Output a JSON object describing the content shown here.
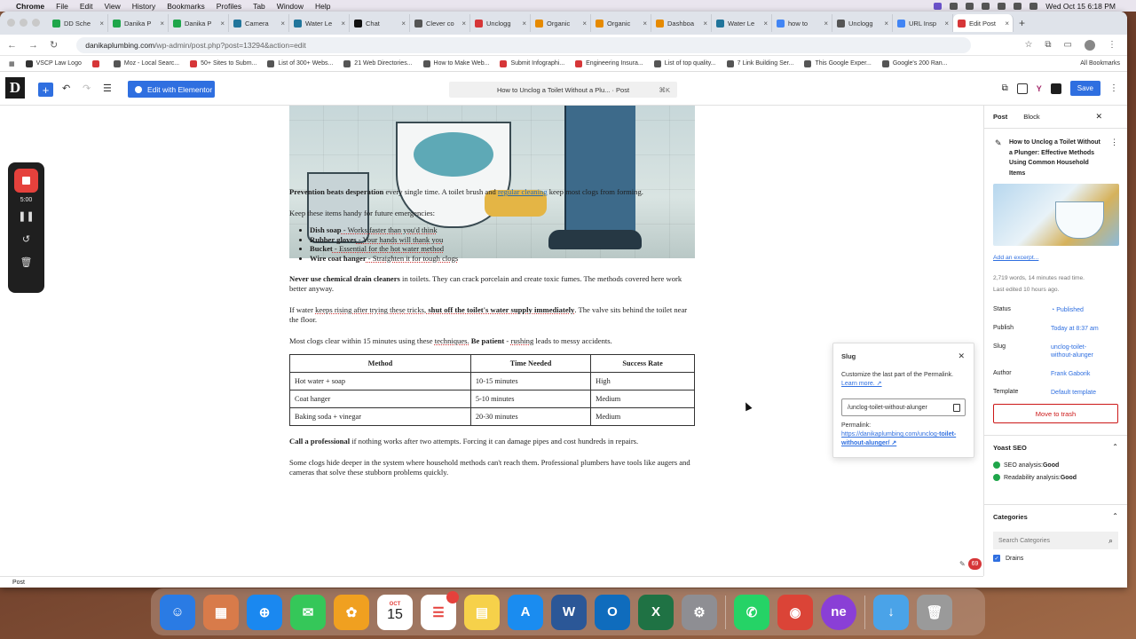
{
  "menubar": {
    "apple": "",
    "app": "Chrome",
    "items": [
      "File",
      "Edit",
      "View",
      "History",
      "Bookmarks",
      "Profiles",
      "Tab",
      "Window",
      "Help"
    ],
    "datetime": "Wed Oct 15  6:18 PM"
  },
  "tabs": [
    {
      "label": "DD Sche",
      "color": "#1fa64a"
    },
    {
      "label": "Danika P",
      "color": "#1fa64a"
    },
    {
      "label": "Danika P",
      "color": "#1fa64a"
    },
    {
      "label": "Camera",
      "color": "#21759b"
    },
    {
      "label": "Water Le",
      "color": "#21759b"
    },
    {
      "label": "Chat",
      "color": "#111111"
    },
    {
      "label": "Clever co",
      "color": "#555555"
    },
    {
      "label": "Unclogg",
      "color": "#d63638"
    },
    {
      "label": "Organic",
      "color": "#e68a00"
    },
    {
      "label": "Organic",
      "color": "#e68a00"
    },
    {
      "label": "Dashboa",
      "color": "#e68a00"
    },
    {
      "label": "Water Le",
      "color": "#21759b"
    },
    {
      "label": "how to",
      "color": "#4285f4"
    },
    {
      "label": "Unclogg",
      "color": "#555555"
    },
    {
      "label": "URL Insp",
      "color": "#4285f4"
    },
    {
      "label": "Edit Post",
      "color": "#d63638",
      "active": true
    }
  ],
  "address": {
    "domain": "danikaplumbing.com",
    "path": "/wp-admin/post.php?post=13294&action=edit"
  },
  "bookmarks": [
    {
      "label": "VSCP Law Logo",
      "color": "#333"
    },
    {
      "label": "",
      "color": "#d63638"
    },
    {
      "label": "Moz - Local Searc...",
      "color": "#555"
    },
    {
      "label": "50+ Sites to Subm...",
      "color": "#d63638"
    },
    {
      "label": "List of 300+ Webs...",
      "color": "#555"
    },
    {
      "label": "21 Web Directories...",
      "color": "#555"
    },
    {
      "label": "How to Make Web...",
      "color": "#555"
    },
    {
      "label": "Submit Infographi...",
      "color": "#d63638"
    },
    {
      "label": "Engineering Insura...",
      "color": "#d63638"
    },
    {
      "label": "List of top quality...",
      "color": "#555"
    },
    {
      "label": "7 Link Building Ser...",
      "color": "#555"
    },
    {
      "label": "This Google Exper...",
      "color": "#555"
    },
    {
      "label": "Google's 200 Ran...",
      "color": "#555"
    }
  ],
  "bookmarks_all": "All Bookmarks",
  "wp": {
    "logo": "D",
    "elementor": "Edit with Elementor",
    "doc_title": "How to Unclog a Toilet Without a Plu...",
    "doc_type": "· Post",
    "shortcut": "⌘K",
    "save": "Save"
  },
  "recorder": {
    "time": "5:00"
  },
  "article": {
    "p1_bold": "Prevention beats desperation",
    "p1_a": " every single time. A toilet brush and ",
    "p1_link": "regular cleaning",
    "p1_b": " keep most clogs from forming.",
    "p2": "Keep these items handy for future emergencies:",
    "list": [
      {
        "b": "Dish soap",
        "t": " - Works faster than you'd think"
      },
      {
        "b": "Rubber gloves",
        "t": " - Your hands will thank you"
      },
      {
        "b": "Bucket",
        "t": " - Essential for the hot water method"
      },
      {
        "b": "Wire coat hanger",
        "t": " - Straighten it for tough clogs"
      }
    ],
    "p3_bold": "Never use chemical drain cleaners",
    "p3_t": " in toilets. They can crack porcelain and create toxic fumes. The methods covered here work better anyway.",
    "p4_a": "If water ",
    "p4_u": "keeps rising after trying these tricks,",
    "p4_bold": " shut off the toilet's water supply immediately",
    "p4_b": ". The valve sits behind the toilet near the floor.",
    "p5_a": "Most clogs clear within 15 minutes using these ",
    "p5_u": "techniques.",
    "p5_bold": " Be patient",
    "p5_b": " - ",
    "p5_u2": "rushing",
    "p5_c": " leads to messy accidents.",
    "table": {
      "headers": [
        "Method",
        "Time Needed",
        "Success Rate"
      ],
      "rows": [
        [
          "Hot water + soap",
          "10-15 minutes",
          "High"
        ],
        [
          "Coat hanger",
          "5-10 minutes",
          "Medium"
        ],
        [
          "Baking soda + vinegar",
          "20-30 minutes",
          "Medium"
        ]
      ]
    },
    "p6_bold": "Call a professional",
    "p6_t": " if nothing works after two attempts. Forcing it can damage pipes and cost hundreds in repairs.",
    "p7": "Some clogs hide deeper in the system where household methods can't reach them. Professional plumbers have tools like augers and cameras that solve these stubborn problems quickly."
  },
  "slug_popover": {
    "title": "Slug",
    "help": "Customize the last part of the Permalink.",
    "learn": "Learn more. ↗",
    "value": "/unclog-toilet-without-alunger",
    "permalink_label": "Permalink:",
    "permalink_a": "https://danikaplumbing.com/unclog-",
    "permalink_b": "toilet-without-alunger/ ↗"
  },
  "sidebar": {
    "tab_post": "Post",
    "tab_block": "Block",
    "post_title": "How to Unclog a Toilet Without a Plunger: Effective Methods Using Common Household Items",
    "add_excerpt": "Add an excerpt...",
    "stats1": "2,719 words, 14 minutes read time.",
    "stats2": "Last edited 10 hours ago.",
    "status_label": "Status",
    "status_val": "Published",
    "publish_label": "Publish",
    "publish_val": "Today at 8:37 am",
    "slug_label": "Slug",
    "slug_val1": "unclog-toilet-",
    "slug_val2": "without-alunger",
    "author_label": "Author",
    "author_val": "Frank Gaborik",
    "template_label": "Template",
    "template_val": "Default template",
    "trash": "Move to trash",
    "yoast_title": "Yoast SEO",
    "seo_a": "SEO analysis: ",
    "seo_b": "Good",
    "read_a": "Readability analysis: ",
    "read_b": "Good",
    "cat_title": "Categories",
    "cat_search": "Search Categories",
    "cat_item": "Drains"
  },
  "badge": "69",
  "status_bar": "Post",
  "dock": [
    {
      "name": "finder",
      "color": "#2a7be4",
      "glyph": "☺"
    },
    {
      "name": "launchpad",
      "color": "#d87b4a",
      "glyph": "▦"
    },
    {
      "name": "safari",
      "color": "#1a88f0",
      "glyph": "⊕"
    },
    {
      "name": "messages",
      "color": "#35c759",
      "glyph": "✉"
    },
    {
      "name": "photos",
      "color": "#f0a020",
      "glyph": "✿"
    },
    {
      "name": "calendar",
      "color": "#ffffff",
      "glyph": "15"
    },
    {
      "name": "reminders",
      "color": "#ffffff",
      "glyph": "☰",
      "badge": "3"
    },
    {
      "name": "notes",
      "color": "#f6d14a",
      "glyph": "▤"
    },
    {
      "name": "app-store",
      "color": "#1a8cf0",
      "glyph": "A"
    },
    {
      "name": "word",
      "color": "#2b5797",
      "glyph": "W"
    },
    {
      "name": "outlook",
      "color": "#0f6cbd",
      "glyph": "O"
    },
    {
      "name": "excel",
      "color": "#1f7244",
      "glyph": "X"
    },
    {
      "name": "settings",
      "color": "#8e8e93",
      "glyph": "⚙"
    },
    {
      "name": "whatsapp",
      "color": "#25d366",
      "glyph": "✆"
    },
    {
      "name": "chrome",
      "color": "#db4437",
      "glyph": "◉"
    },
    {
      "name": "ne-app",
      "color": "#8a3fd6",
      "glyph": "ne"
    },
    {
      "name": "downloads",
      "color": "#4aa3e8",
      "glyph": "↓"
    },
    {
      "name": "trash",
      "color": "#9a9a9a",
      "glyph": "🗑"
    }
  ],
  "calendar": {
    "month": "OCT",
    "day": "15"
  }
}
